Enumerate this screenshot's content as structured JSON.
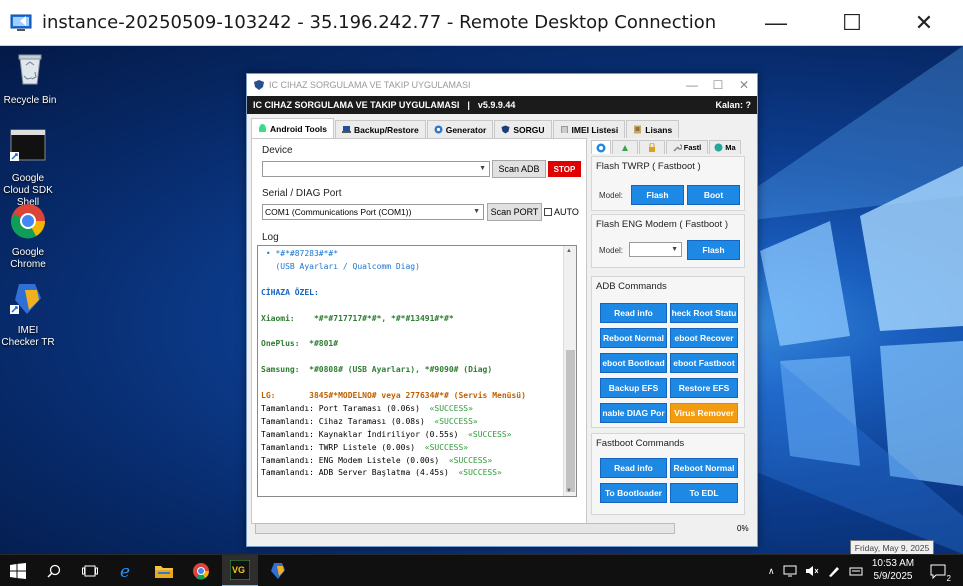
{
  "rdp": {
    "title": "instance-20250509-103242 - 35.196.242.77 - Remote Desktop Connection",
    "minimize_glyph": "—",
    "maximize_glyph": "☐",
    "close_glyph": "✕"
  },
  "desktop_icons": [
    {
      "label": "Recycle Bin",
      "icon": "recycle-bin-icon"
    },
    {
      "label": "Google Cloud SDK Shell",
      "icon": "sdk-shell-icon"
    },
    {
      "label": "Google Chrome",
      "icon": "chrome-icon"
    },
    {
      "label": "IMEI Checker TR",
      "icon": "imei-checker-icon"
    }
  ],
  "app": {
    "window_title": "IC CIHAZ SORGULAMA VE TAKIP UYGULAMASI",
    "header_title": "IC CIHAZ SORGULAMA VE TAKIP UYGULAMASI",
    "header_sep": "|",
    "version": "v5.9.9.44",
    "kalan": "Kalan: ?",
    "tabs": [
      {
        "label": "Android Tools",
        "icon": "android-icon",
        "active": true
      },
      {
        "label": "Backup/Restore",
        "icon": "laptop-icon",
        "active": false
      },
      {
        "label": "Generator",
        "icon": "generator-icon",
        "active": false
      },
      {
        "label": "SORGU",
        "icon": "shield-icon",
        "active": false
      },
      {
        "label": "IMEI Listesi",
        "icon": "list-icon",
        "active": false
      },
      {
        "label": "Lisans",
        "icon": "license-icon",
        "active": false
      }
    ],
    "device": {
      "label": "Device",
      "value": "",
      "scan_label": "Scan ADB",
      "stop_label": "STOP"
    },
    "serial": {
      "label": "Serial / DIAG Port",
      "value": "COM1 (Communications Port (COM1))",
      "scan_label": "Scan PORT",
      "auto_label": "AUTO",
      "auto_checked": false
    },
    "log": {
      "label": "Log",
      "lines": [
        {
          "text": " • *#*#87283#*#*",
          "cls": "c-blue"
        },
        {
          "text": "   (USB Ayarları / Qualcomm Diag)",
          "cls": "c-blue"
        },
        {
          "text": "",
          "cls": ""
        },
        {
          "text": "CİHAZA ÖZEL:",
          "cls": "c-head"
        },
        {
          "text": "",
          "cls": ""
        },
        {
          "text": "Xiaomi:    *#*#717717#*#*, *#*#13491#*#*",
          "cls": "c-green"
        },
        {
          "text": "",
          "cls": ""
        },
        {
          "text": "OnePlus:  *#801#",
          "cls": "c-green"
        },
        {
          "text": "",
          "cls": ""
        },
        {
          "text": "Samsung:  *#0808# (USB Ayarları), *#9090# (Diag)",
          "cls": "c-green"
        },
        {
          "text": "",
          "cls": ""
        },
        {
          "text": "LG:       3845#*MODELNO# veya 277634#*# (Servis Menüsü)",
          "cls": "c-brown"
        },
        {
          "text": "Tamamlandı: Port Taraması (0.06s)  «SUCCESS»",
          "cls": ""
        },
        {
          "text": "Tamamlandı: Cihaz Taraması (0.08s)  «SUCCESS»",
          "cls": ""
        },
        {
          "text": "Tamamlandı: Kaynaklar İndiriliyor (0.55s)  «SUCCESS»",
          "cls": ""
        },
        {
          "text": "Tamamlandı: TWRP Listele (0.00s)  «SUCCESS»",
          "cls": ""
        },
        {
          "text": "Tamamlandı: ENG Modem Listele (0.00s)  «SUCCESS»",
          "cls": ""
        },
        {
          "text": "Tamamlandı: ADB Server Başlatma (4.45s)  «SUCCESS»",
          "cls": ""
        }
      ]
    },
    "side_tabs": [
      {
        "label": "",
        "icon": "info-icon"
      },
      {
        "label": "",
        "icon": "arrow-icon"
      },
      {
        "label": "",
        "icon": "lock-icon"
      },
      {
        "label": "Fastl",
        "icon": "wrench-icon"
      },
      {
        "label": "Ma",
        "icon": "globe-icon"
      }
    ],
    "flash_twrp": {
      "title": "Flash TWRP ( Fastboot )",
      "model_label": "Model:",
      "flash_label": "Flash",
      "boot_label": "Boot"
    },
    "flash_eng": {
      "title": "Flash ENG Modem ( Fastboot )",
      "model_label": "Model:",
      "flash_label": "Flash"
    },
    "adb_commands": {
      "title": "ADB Commands",
      "buttons": [
        "Read info",
        "heck Root Statu",
        "Reboot Normal",
        "eboot Recover",
        "eboot Bootload",
        "eboot Fastboot",
        "Backup EFS",
        "Restore EFS",
        "nable DIAG Por",
        "Virus Remover"
      ]
    },
    "fastboot_commands": {
      "title": "Fastboot Commands",
      "buttons": [
        "Read info",
        "Reboot Normal",
        "To Bootloader",
        "To EDL"
      ]
    },
    "progress": {
      "value": 0,
      "label": "0%"
    }
  },
  "taskbar": {
    "clock_time": "10:53 AM",
    "clock_date": "5/9/2025",
    "tooltip": "Friday, May 9, 2025",
    "notification_count": "2"
  }
}
